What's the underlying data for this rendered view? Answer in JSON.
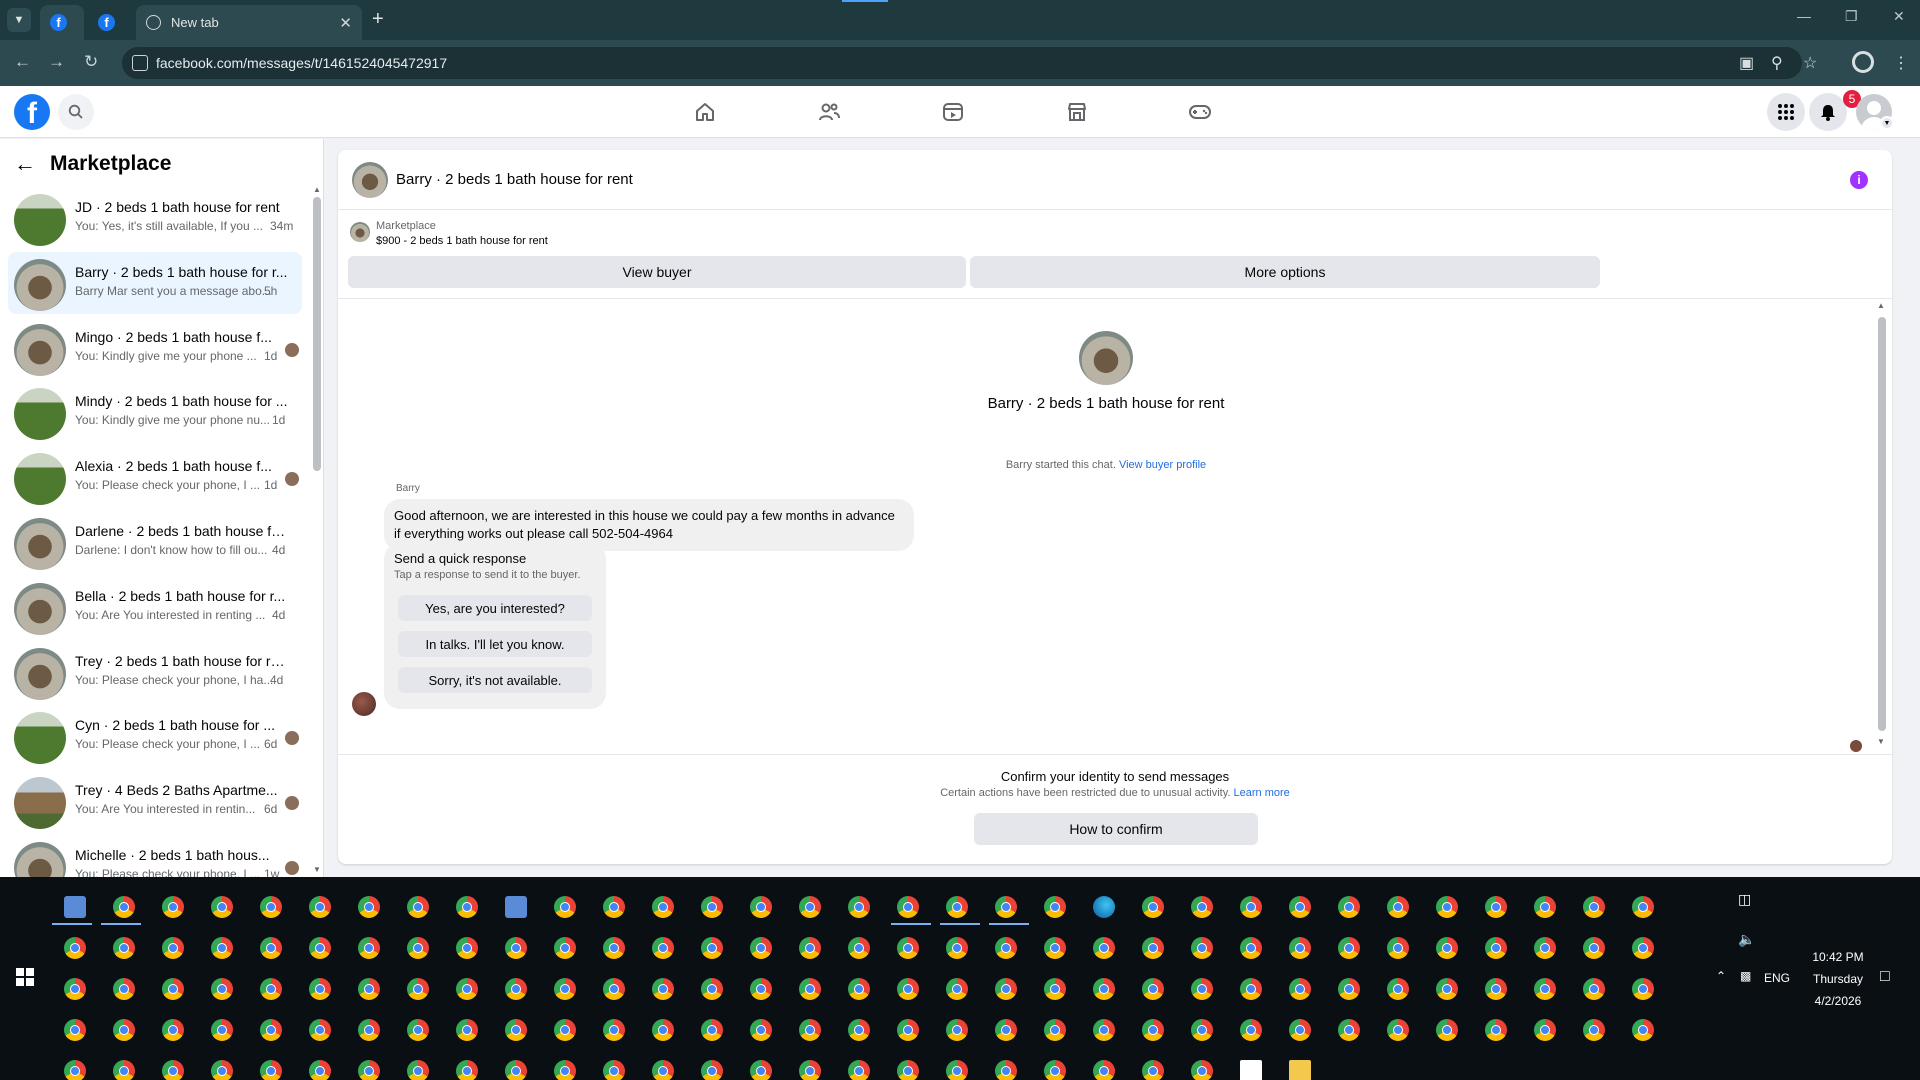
{
  "browser": {
    "tabs": [
      {
        "title": "",
        "favicon": "facebook-icon"
      },
      {
        "title": "",
        "favicon": "facebook-icon"
      },
      {
        "title": "New tab",
        "favicon": "globe-icon"
      }
    ],
    "new_tab_symbol": "+",
    "url": "facebook.com/messages/t/1461524045472917"
  },
  "fb": {
    "logo": "f",
    "notifications_count": "5"
  },
  "sidebar": {
    "title": "Marketplace",
    "conversations": [
      {
        "name": "JD · 2 beds 1 bath house for rent",
        "preview": "You: Yes, it's still available, If you ...",
        "time": "34m",
        "thumb": "lawn"
      },
      {
        "name": "Barry · 2 beds 1 bath house for r...",
        "preview": "Barry Mar sent you a message abo...",
        "time": "5h",
        "thumb": "house",
        "active": true
      },
      {
        "name": "Mingo · 2 beds 1 bath house f...",
        "preview": "You: Kindly give me your phone ...",
        "time": "1d",
        "thumb": "house"
      },
      {
        "name": "Mindy · 2 beds 1 bath house for ...",
        "preview": "You: Kindly give me your phone nu...",
        "time": "1d",
        "thumb": "lawn"
      },
      {
        "name": "Alexia · 2 beds 1 bath house f...",
        "preview": "You: Please check your phone, I ...",
        "time": "1d",
        "thumb": "lawn"
      },
      {
        "name": "Darlene · 2 beds 1 bath house fo...",
        "preview": "Darlene: I don't know how to fill ou...",
        "time": "4d",
        "thumb": "house"
      },
      {
        "name": "Bella · 2 beds 1 bath house for r...",
        "preview": "You: Are You interested in renting ...",
        "time": "4d",
        "thumb": "house"
      },
      {
        "name": "Trey · 2 beds 1 bath house for rent",
        "preview": "You: Please check your phone, I ha...",
        "time": "4d",
        "thumb": "house"
      },
      {
        "name": "Cyn · 2 beds 1 bath house for ...",
        "preview": "You: Please check your phone, I ...",
        "time": "6d",
        "thumb": "lawn"
      },
      {
        "name": "Trey · 4 Beds 2 Baths Apartme...",
        "preview": "You: Are You interested in rentin...",
        "time": "6d",
        "thumb": "apt"
      },
      {
        "name": "Michelle · 2 beds 1 bath hous...",
        "preview": "You: Please check your phone, I ...",
        "time": "1w",
        "thumb": "house"
      }
    ]
  },
  "chat": {
    "title": "Barry · 2 beds 1 bath house for rent",
    "marketplace_label": "Marketplace",
    "listing": "$900 - 2 beds 1 bath house for rent",
    "view_buyer": "View buyer",
    "more_options": "More options",
    "started_text": "Barry started this chat.",
    "view_buyer_profile": "View buyer profile",
    "sender": "Barry",
    "message": "Good afternoon, we are interested in this house we could pay a few months in advance if everything works out please call 502-504-4964",
    "quick_response": {
      "heading": "Send a quick response",
      "subtext": "Tap a response to send it to the buyer.",
      "options": [
        "Yes, are you interested?",
        "In talks. I'll let you know.",
        "Sorry, it's not available."
      ]
    }
  },
  "confirm": {
    "title": "Confirm your identity to send messages",
    "subtext": "Certain actions have been restricted due to unusual activity.",
    "learn_more": "Learn more",
    "button": "How to confirm"
  },
  "system_tray": {
    "language": "ENG",
    "time": "10:42 PM",
    "day": "Thursday",
    "date": "4/2/2026"
  },
  "colors": {
    "fb_blue": "#1877f2",
    "chrome_frame": "#1f3a3f",
    "link_blue": "#216fdb",
    "badge_red": "#e41e3f"
  }
}
